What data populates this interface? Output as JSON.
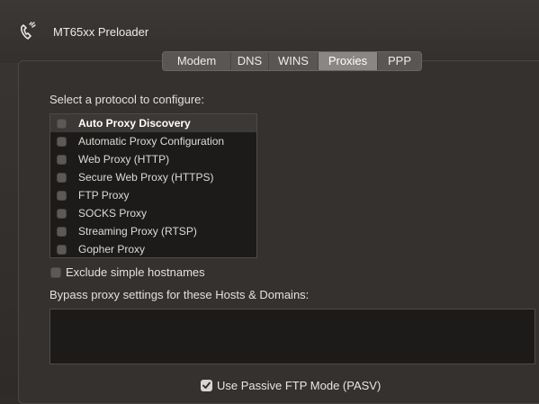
{
  "header": {
    "title": "MT65xx Preloader",
    "icon": "phone-signal-icon"
  },
  "tabs": [
    {
      "label": "Modem",
      "active": false
    },
    {
      "label": "DNS",
      "active": false
    },
    {
      "label": "WINS",
      "active": false
    },
    {
      "label": "Proxies",
      "active": true
    },
    {
      "label": "PPP",
      "active": false
    }
  ],
  "proxies": {
    "section_label": "Select a protocol to configure:",
    "protocols": [
      {
        "label": "Auto Proxy Discovery",
        "checked": false,
        "selected": true
      },
      {
        "label": "Automatic Proxy Configuration",
        "checked": false,
        "selected": false
      },
      {
        "label": "Web Proxy (HTTP)",
        "checked": false,
        "selected": false
      },
      {
        "label": "Secure Web Proxy (HTTPS)",
        "checked": false,
        "selected": false
      },
      {
        "label": "FTP Proxy",
        "checked": false,
        "selected": false
      },
      {
        "label": "SOCKS Proxy",
        "checked": false,
        "selected": false
      },
      {
        "label": "Streaming Proxy (RTSP)",
        "checked": false,
        "selected": false
      },
      {
        "label": "Gopher Proxy",
        "checked": false,
        "selected": false
      }
    ],
    "exclude_simple_hostnames": {
      "label": "Exclude simple hostnames",
      "checked": false
    },
    "bypass_label": "Bypass proxy settings for these Hosts & Domains:",
    "bypass_value": "",
    "passive_ftp": {
      "label": "Use Passive FTP Mode (PASV)",
      "checked": true
    }
  },
  "colors": {
    "background": "#2f2c29",
    "list_background": "#1d1b1a",
    "active_tab": "#8a8683"
  }
}
